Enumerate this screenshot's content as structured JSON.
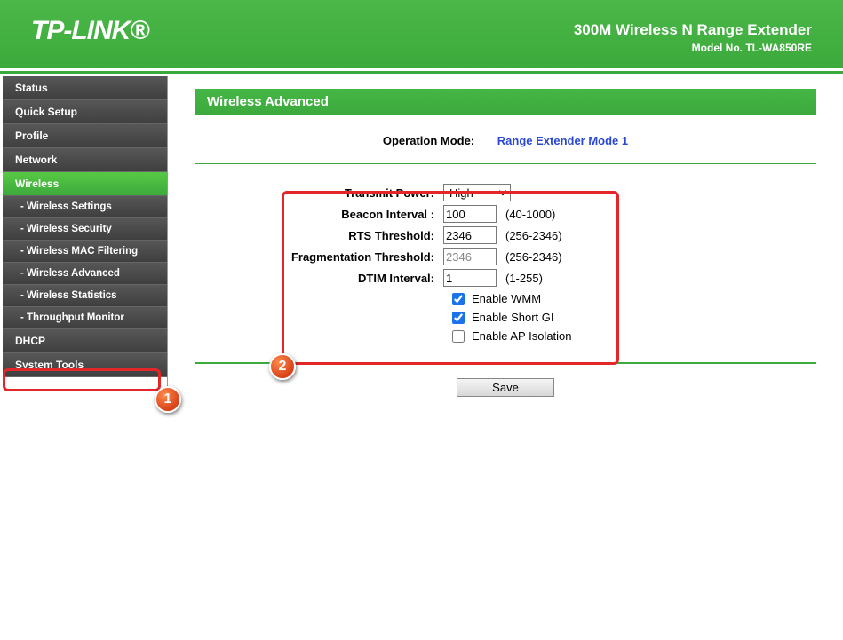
{
  "header": {
    "logo": "TP-LINK®",
    "product": "300M Wireless N Range Extender",
    "model": "Model No. TL-WA850RE"
  },
  "sidebar": {
    "items": [
      {
        "label": "Status",
        "type": "top"
      },
      {
        "label": "Quick Setup",
        "type": "top"
      },
      {
        "label": "Profile",
        "type": "top"
      },
      {
        "label": "Network",
        "type": "top"
      },
      {
        "label": "Wireless",
        "type": "top",
        "active_parent": true
      },
      {
        "label": "- Wireless Settings",
        "type": "sub"
      },
      {
        "label": "- Wireless Security",
        "type": "sub"
      },
      {
        "label": "- Wireless MAC Filtering",
        "type": "sub"
      },
      {
        "label": "- Wireless Advanced",
        "type": "sub",
        "active": true
      },
      {
        "label": "- Wireless Statistics",
        "type": "sub"
      },
      {
        "label": "- Throughput Monitor",
        "type": "sub"
      },
      {
        "label": "DHCP",
        "type": "top"
      },
      {
        "label": "System Tools",
        "type": "top"
      }
    ]
  },
  "page": {
    "title": "Wireless Advanced",
    "op_mode_label": "Operation Mode:",
    "op_mode_value": "Range Extender Mode 1",
    "labels": {
      "transmit_power": "Transmit Power:",
      "beacon_interval": "Beacon Interval :",
      "rts_threshold": "RTS Threshold:",
      "frag_threshold": "Fragmentation Threshold:",
      "dtim_interval": "DTIM Interval:",
      "enable_wmm": "Enable WMM",
      "enable_short_gi": "Enable Short GI",
      "enable_ap_isolation": "Enable AP Isolation"
    },
    "values": {
      "transmit_power": "High",
      "beacon_interval": "100",
      "rts_threshold": "2346",
      "frag_threshold": "2346",
      "dtim_interval": "1",
      "enable_wmm": true,
      "enable_short_gi": true,
      "enable_ap_isolation": false
    },
    "hints": {
      "beacon_interval": "(40-1000)",
      "rts_threshold": "(256-2346)",
      "frag_threshold": "(256-2346)",
      "dtim_interval": "(1-255)"
    },
    "save_label": "Save"
  },
  "annotations": {
    "callout1": "1",
    "callout2": "2"
  }
}
